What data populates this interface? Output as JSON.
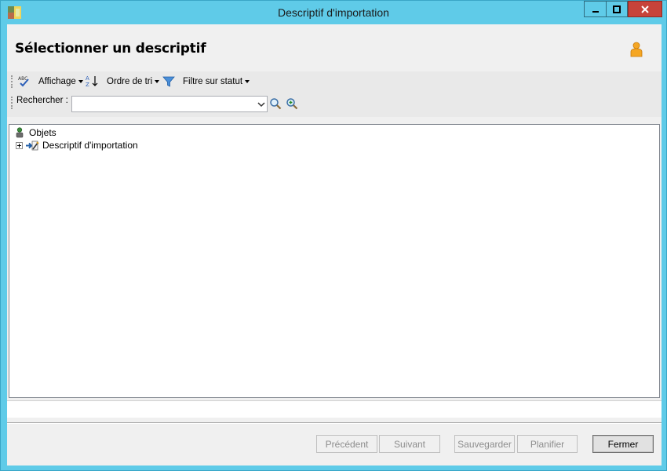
{
  "window": {
    "title": "Descriptif d'importation",
    "controls": {
      "minimize": "minimize",
      "maximize": "maximize",
      "close": "close"
    }
  },
  "header": {
    "title": "Sélectionner un descriptif",
    "icon": "user-icon"
  },
  "toolbar": {
    "spellcheck_icon": "abc-check-icon",
    "affichage_label": "Affichage",
    "sort_icon": "sort-az-icon",
    "ordre_label": "Ordre de tri",
    "filter_icon": "funnel-icon",
    "filtre_label": "Filtre sur statut"
  },
  "search": {
    "label": "Rechercher :",
    "value": "",
    "search_icon": "magnifier-icon",
    "advanced_icon": "magnifier-plus-icon"
  },
  "tree": {
    "root": {
      "label": "Objets",
      "icon": "objects-icon"
    },
    "children": [
      {
        "label": "Descriptif d'importation",
        "icon": "import-descriptor-icon",
        "expander": "+"
      }
    ]
  },
  "buttons": {
    "previous": "Précédent",
    "next": "Suivant",
    "save": "Sauvegarder",
    "schedule": "Planifier",
    "close": "Fermer"
  },
  "colors": {
    "titlebar": "#5fcbe8",
    "close_button": "#c7433a",
    "client_bg": "#f0f0f0"
  }
}
